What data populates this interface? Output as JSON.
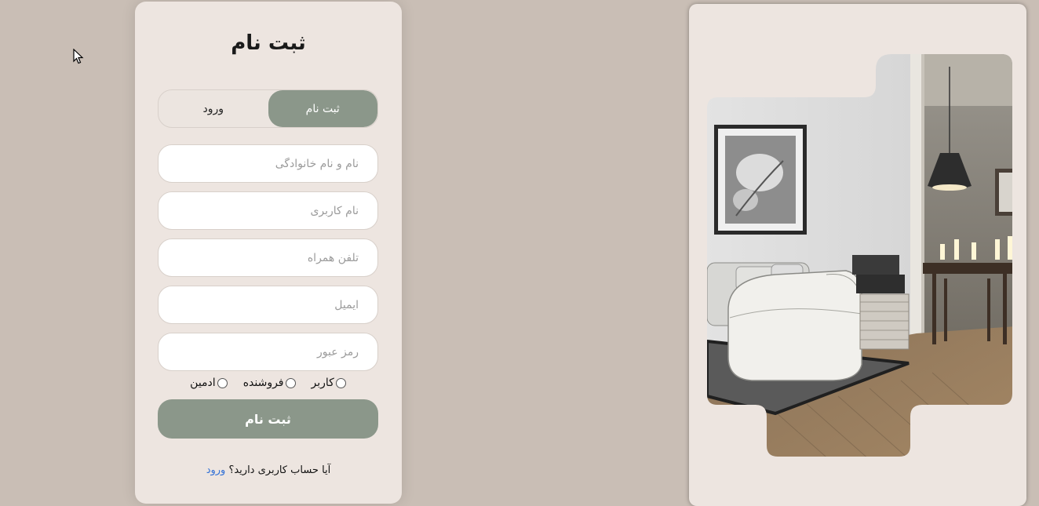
{
  "form": {
    "title": "ثبت نام",
    "tabs": [
      {
        "label": "ثبت نام",
        "active": true
      },
      {
        "label": "ورود",
        "active": false
      }
    ],
    "fields": [
      {
        "placeholder": "نام و نام خانوادگی",
        "value": ""
      },
      {
        "placeholder": "نام کاربری",
        "value": ""
      },
      {
        "placeholder": "تلفن همراه",
        "value": ""
      },
      {
        "placeholder": "ایمیل",
        "value": ""
      },
      {
        "placeholder": "رمز عبور",
        "value": ""
      }
    ],
    "roles": [
      {
        "label": "کاربر",
        "checked": false
      },
      {
        "label": "فروشنده",
        "checked": false
      },
      {
        "label": "ادمین",
        "checked": false
      }
    ],
    "submit_label": "ثبت نام",
    "footer_question": "آیا حساب کاربری دارید؟",
    "footer_link": "ورود"
  },
  "colors": {
    "background": "#c9beb5",
    "card": "#ede5e0",
    "accent": "#8b978a",
    "link": "#2f6fd6"
  },
  "icons": {
    "cursor": "mouse-pointer-icon",
    "photo": "living-room-interior-image"
  }
}
